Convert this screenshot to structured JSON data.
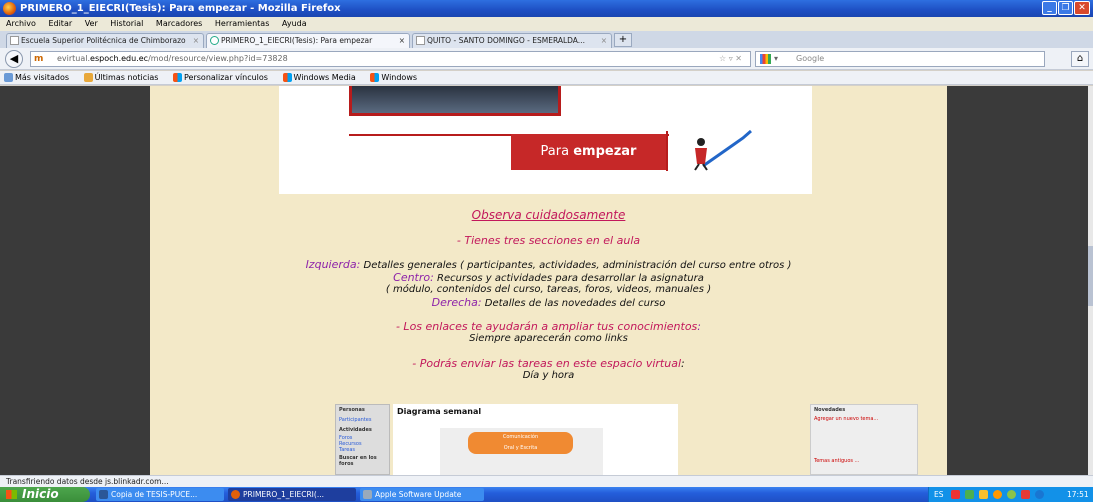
{
  "window": {
    "title": "PRIMERO_1_EIECRI(Tesis): Para empezar - Mozilla Firefox"
  },
  "menu": [
    "Archivo",
    "Editar",
    "Ver",
    "Historial",
    "Marcadores",
    "Herramientas",
    "Ayuda"
  ],
  "tabs": [
    {
      "label": "Escuela Superior Politécnica de Chimborazo"
    },
    {
      "label": "PRIMERO_1_EIECRI(Tesis): Para empezar"
    },
    {
      "label": "QUITO - SANTO DOMINGO - ESMERALDA..."
    }
  ],
  "nav": {
    "url_prefix": "evirtual.",
    "url_domain": "espoch.edu.ec",
    "url_path": "/mod/resource/view.php?id=73828",
    "search_placeholder": "Google"
  },
  "bookmarks": [
    "Más visitados",
    "Últimas noticias",
    "Personalizar vínculos",
    "Windows Media",
    "Windows"
  ],
  "page": {
    "banner_text_normal": "Para ",
    "banner_text_bold": "empezar",
    "heading": "Observa cuidadosamente",
    "sections_title": "- Tienes tres secciones en el aula",
    "izq_label": "Izquierda:",
    "izq_text": " Detalles generales ( participantes, actividades, administración del curso entre otros )",
    "centro_label": "Centro:",
    "centro_text": " Recursos y actividades para desarrollar la asignatura",
    "centro_text2": "( módulo, contenidos del curso, tareas, foros, videos, manuales )",
    "der_label": "Derecha:",
    "der_text": " Detalles de las novedades del curso",
    "links_title": "- Los enlaces te ayudarán a ampliar tus conocimientos",
    "links_colon": ":",
    "links_sub": "Siempre aparecerán como links",
    "tasks_title": "- Podrás enviar las tareas en este espacio virtual",
    "tasks_colon": ":",
    "tasks_sub": "Día y hora"
  },
  "snippet": {
    "left_items": [
      "Personas",
      "Participantes",
      "Actividades",
      "Foros",
      "Recursos",
      "Tareas",
      "Buscar en los foros"
    ],
    "center_title": "Diagrama semanal",
    "center_pill_1": "Comunicación",
    "center_pill_2": "Oral y Escrita",
    "right_head": "Novedades",
    "right_link": "Agregar un nuevo tema...",
    "right_more": "Temas antiguos ..."
  },
  "status": "Transfiriendo datos desde js.blinkadr.com...",
  "taskbar": {
    "start": "Inicio",
    "tasks": [
      "Copia de TESIS-PUCE...",
      "PRIMERO_1_EIECRI(...",
      "Apple Software Update"
    ],
    "lang": "ES",
    "clock": "17:51"
  }
}
